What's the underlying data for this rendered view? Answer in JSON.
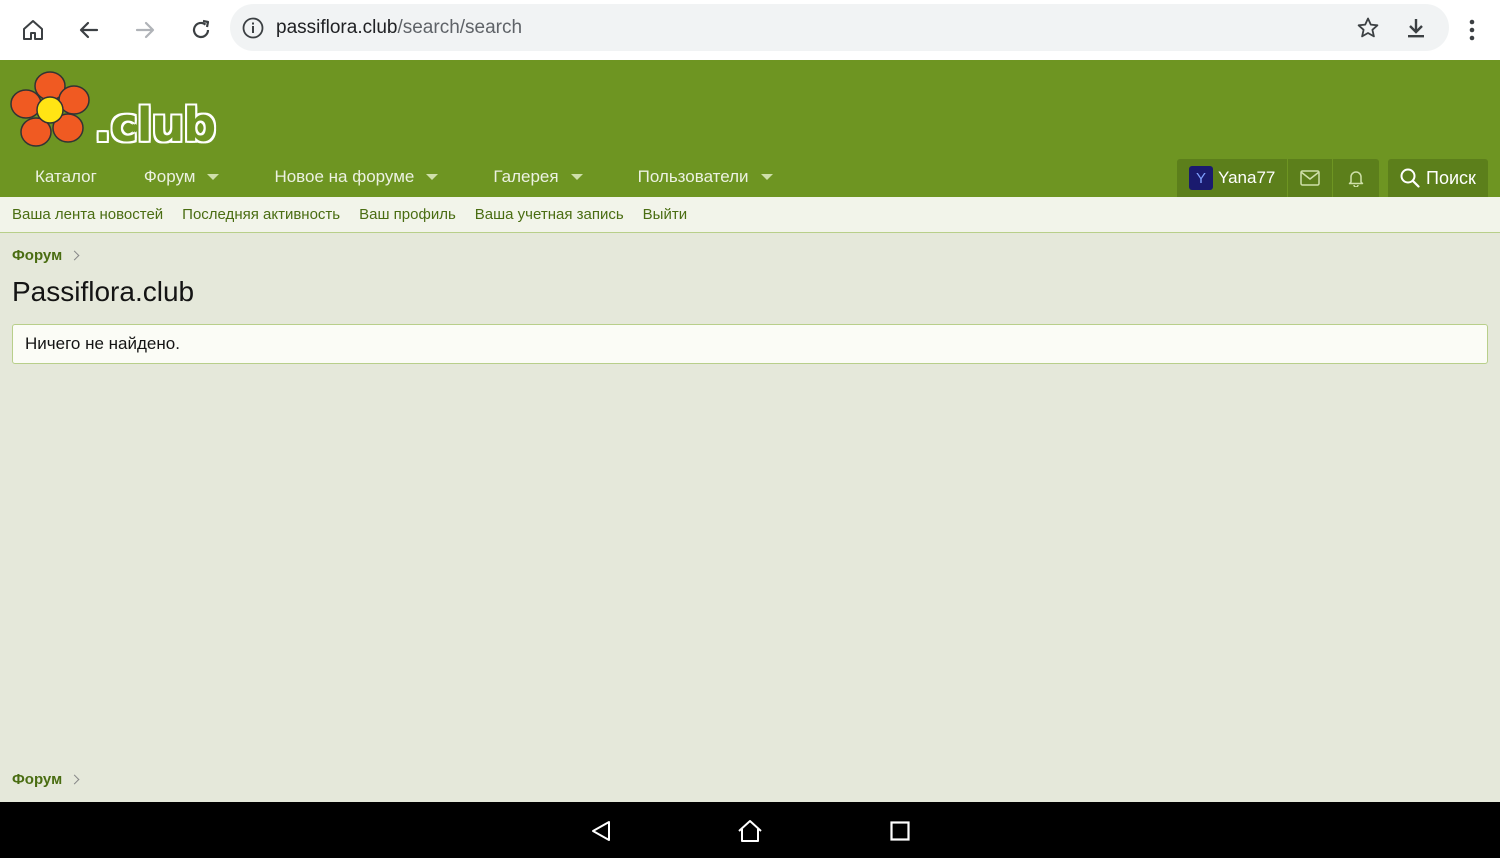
{
  "browser": {
    "url_host": "passiflora.club",
    "url_path": "/search/search"
  },
  "site": {
    "logo_text": ".club",
    "nav": [
      {
        "label": "Каталог"
      },
      {
        "label": "Форум"
      },
      {
        "label": "Новое на форуме"
      },
      {
        "label": "Галерея"
      },
      {
        "label": "Пользователи"
      }
    ],
    "user": {
      "avatar_letter": "Y",
      "name": "Yana77"
    },
    "search_label": "Поиск",
    "subnav": [
      "Ваша лента новостей",
      "Последняя активность",
      "Ваш профиль",
      "Ваша учетная запись",
      "Выйти"
    ]
  },
  "content": {
    "breadcrumb_top": "Форум",
    "title": "Passiflora.club",
    "message": "Ничего не найдено.",
    "breadcrumb_bottom": "Форум"
  },
  "colors": {
    "header_green": "#6e9522",
    "link_green": "#4a6d12",
    "page_bg": "#e5e8da"
  }
}
